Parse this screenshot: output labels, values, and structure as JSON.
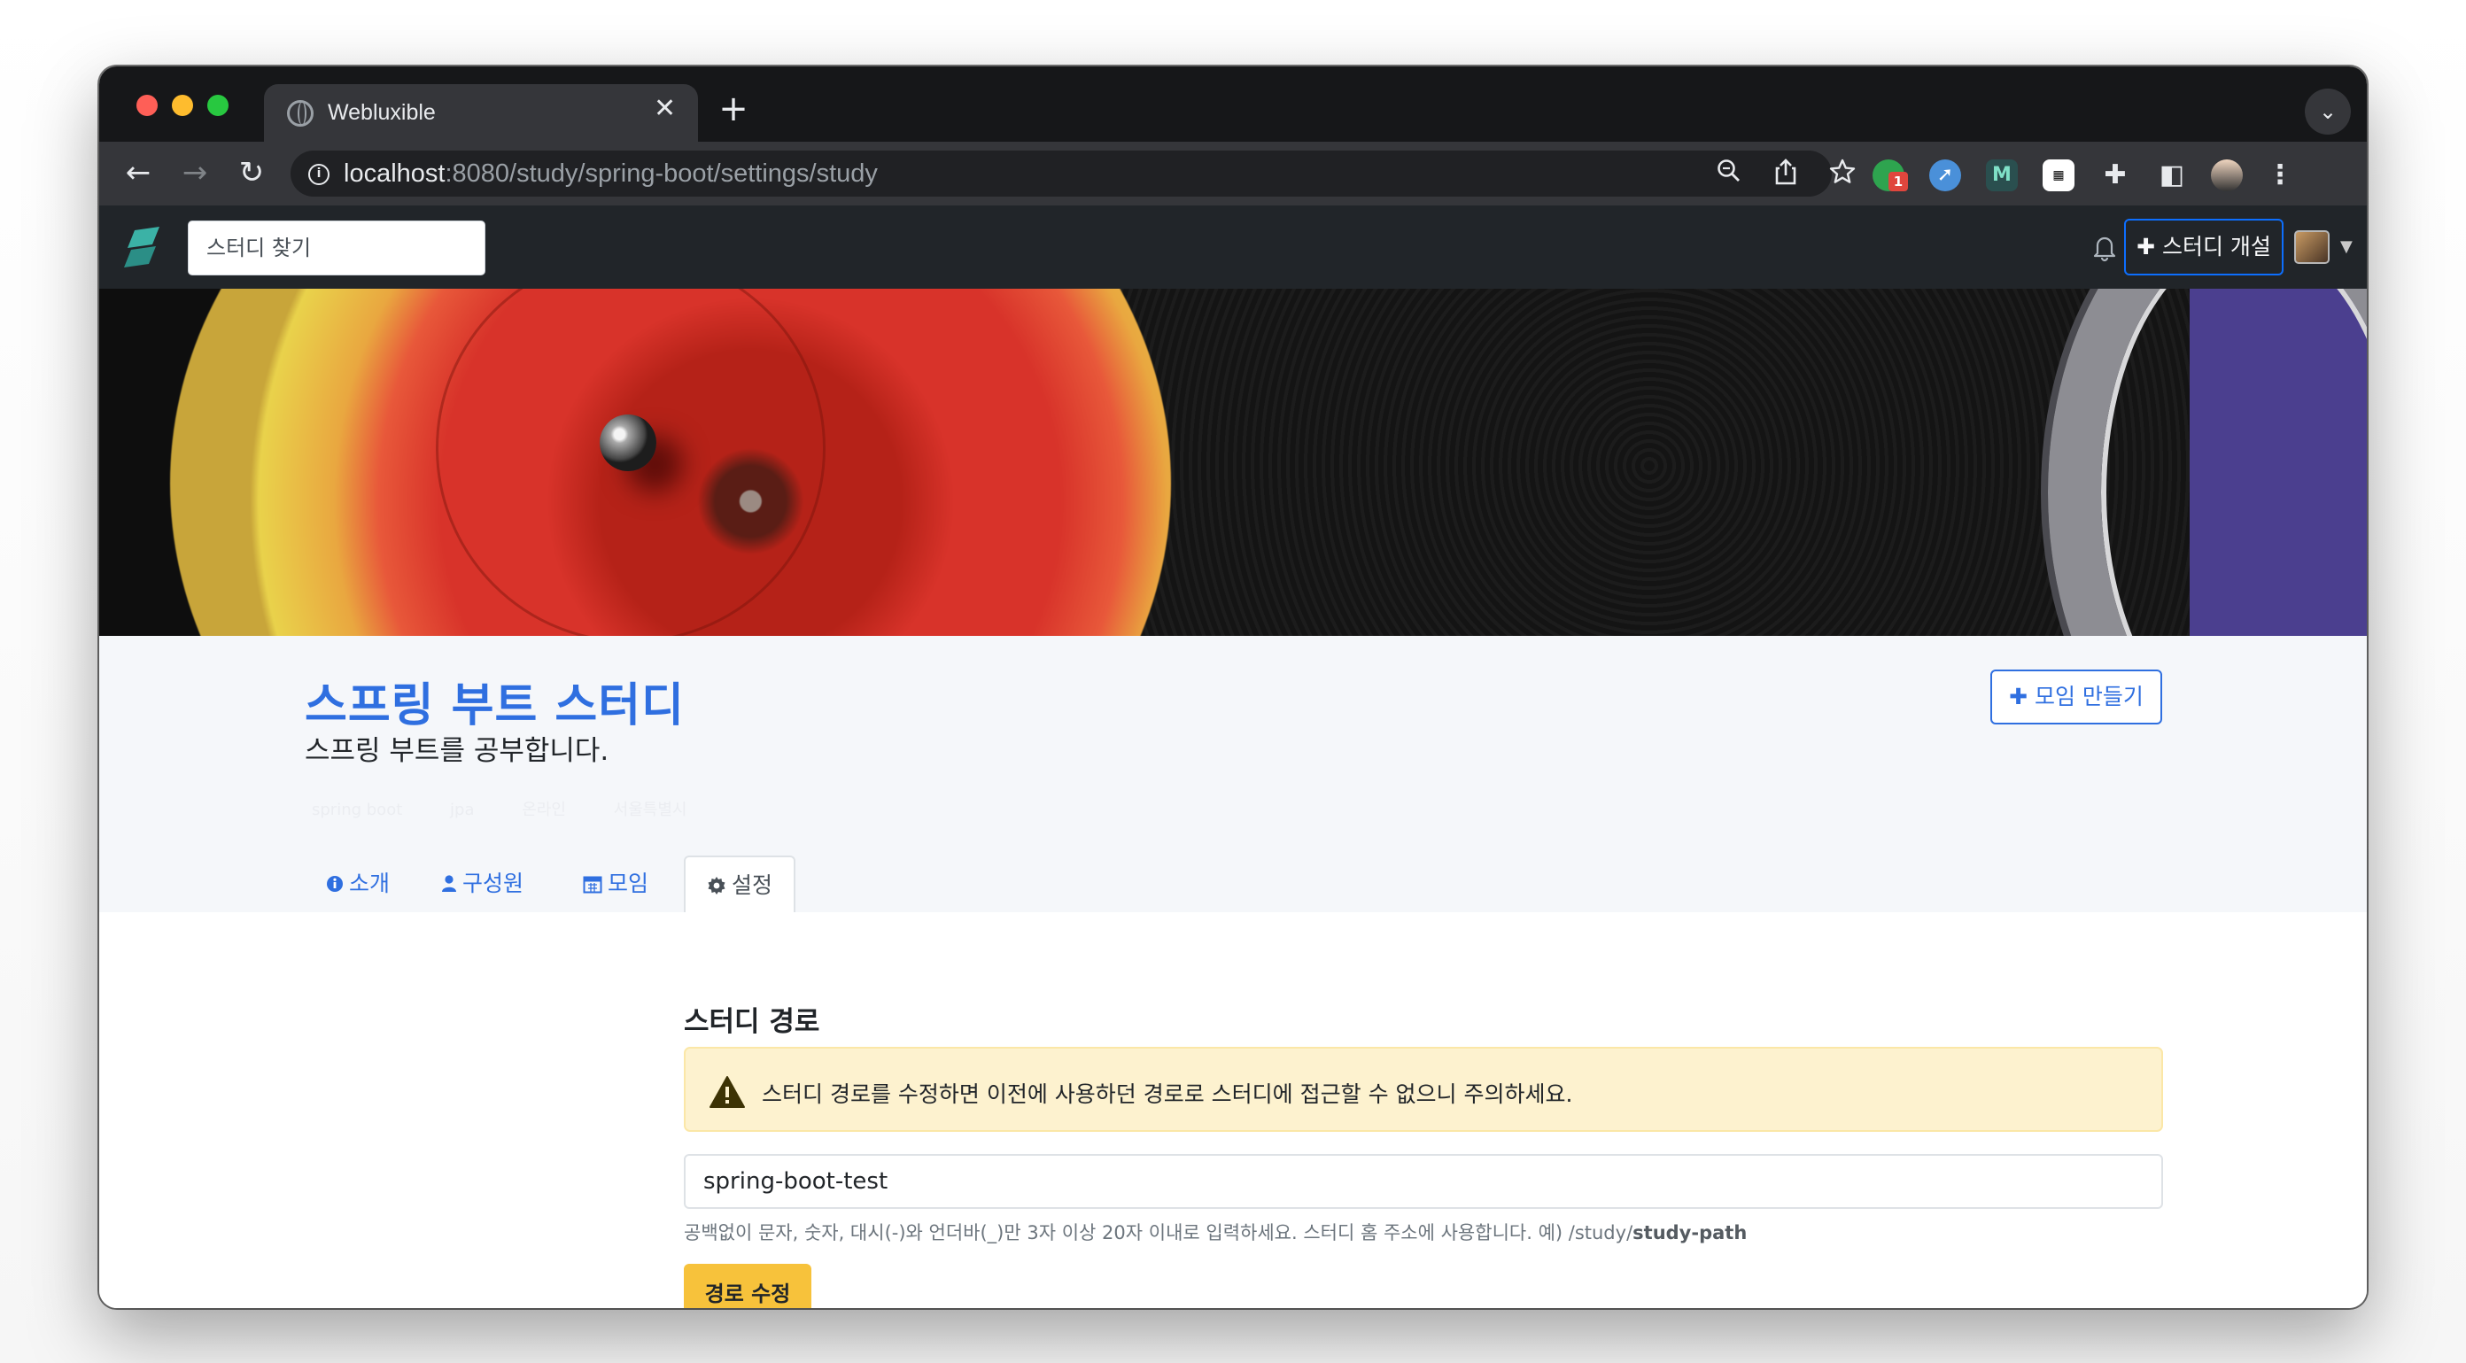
{
  "browser": {
    "tab_title": "Webluxible",
    "tab_close": "✕",
    "new_tab": "+",
    "url_host": "localhost",
    "url_rest": ":8080/study/spring-boot/settings/study",
    "extension_badge": "1"
  },
  "navbar": {
    "search_placeholder": "스터디 찾기",
    "create_study_label": "스터디 개설",
    "brand_color": "#3bb2a6"
  },
  "study": {
    "title": "스프링 부트 스터디",
    "description": "스프링 부트를 공부합니다.",
    "make_meeting_label": "모임 만들기",
    "tags": [
      "spring boot",
      "jpa",
      "온라인",
      "서울특별시"
    ],
    "tabs": [
      {
        "label": "소개",
        "icon": "info-circle-icon"
      },
      {
        "label": "구성원",
        "icon": "user-icon"
      },
      {
        "label": "모임",
        "icon": "calendar-icon"
      },
      {
        "label": "설정",
        "icon": "gear-icon",
        "active": true
      }
    ]
  },
  "settings": {
    "section_title": "스터디 경로",
    "warning": "스터디 경로를 수정하면 이전에 사용하던 경로로 스터디에 접근할 수 없으니 주의하세요.",
    "path_value": "spring-boot-test",
    "help_text_prefix": "공백없이 문자, 숫자, 대시(-)와 언더바(_)만 3자 이상 20자 이내로 입력하세요. 스터디 홈 주소에 사용합니다. 예) /study/",
    "help_text_bold": "study-path",
    "save_label": "경로 수정",
    "colors": {
      "accent": "#2f6fe0",
      "warning_bg": "#fdf2cf",
      "button": "#f7c23b"
    }
  }
}
